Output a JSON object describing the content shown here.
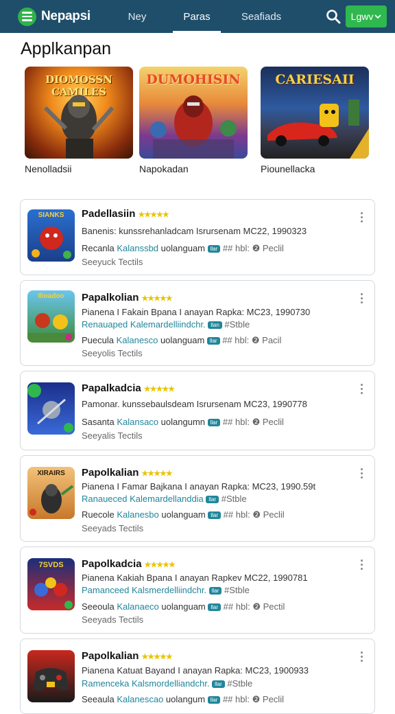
{
  "nav": {
    "brand": "Nepapsi",
    "tabs": [
      "Ney",
      "Paras",
      "Seafiads"
    ],
    "active_tab": "Paras",
    "login_label": "Lgwv"
  },
  "section_title": "Applkanpan",
  "featured": [
    {
      "caption": "Nenolladsii",
      "art_title": "DIOMOSSN CAMILES"
    },
    {
      "caption": "Napokadan",
      "art_title": "DUMOHISIN"
    },
    {
      "caption": "Piounellacka",
      "art_title": "CARIESAII"
    }
  ],
  "apps": [
    {
      "name": "Padellasiin",
      "stars": "★★★★★",
      "desc": "Banenis: kunssrehanladcam Isrursenam MC22, 1990323",
      "sub": "",
      "meta": {
        "prefix": "Recanla",
        "link": "Kalanssbd",
        "tail": "uolanguam",
        "pill": "llar",
        "tags": "## hbl:",
        "extra": "Peclil"
      },
      "foot": "Seeyuck Tectils",
      "icon_label": "SIANKS"
    },
    {
      "name": "Papalkolian",
      "stars": "★★★★★",
      "desc": "Pianena I Fakain Bpana I anayan Rapka: MC23, 1990730",
      "sub": {
        "text": "Renauaped Kalemardelliindchr.",
        "pill": "llan",
        "tag": "#Stble"
      },
      "meta": {
        "prefix": "Puecula",
        "link": "Kalanesco",
        "tail": "uolanguam",
        "pill": "llar",
        "tags": "## hbl:",
        "extra": "Pacil"
      },
      "foot": "Seeyolis Tectils",
      "icon_label": "Ilioadoo"
    },
    {
      "name": "Papalkadcia",
      "stars": "★★★★★",
      "desc": "Pamonar. kunssebaulsdeam Isrursenam MC23, 1990778",
      "sub": "",
      "meta": {
        "prefix": "Sasanta",
        "link": "Kalansaco",
        "tail": "uolangumn",
        "pill": "llar",
        "tags": "## hbl:",
        "extra": "Peclil"
      },
      "foot": "Seeyalis Tectils",
      "icon_label": ""
    },
    {
      "name": "Papolkalian",
      "stars": "★★★★★",
      "desc": "Pianena I Famar Bajkana I anayan Rapka: MC23, 1990.59t",
      "sub": {
        "text": "Ranaueced Kalemardellanddia",
        "pill": "llar",
        "tag": "#Stble"
      },
      "meta": {
        "prefix": "Ruecole",
        "link": "Kalanesbo",
        "tail": "uolanguam",
        "pill": "llar",
        "tags": "## hbl:",
        "extra": "Peclil"
      },
      "foot": "Seeyads Tectils",
      "icon_label": "XIRAIRS"
    },
    {
      "name": "Papolkadcia",
      "stars": "★★★★★",
      "desc": "Pianena Kakiah Bpana I anayan Rapkev MC22, 1990781",
      "sub": {
        "text": "Pamanceed Kalsmerdelliindchr.",
        "pill": "llar",
        "tag": "#Stble"
      },
      "meta": {
        "prefix": "Seeoula",
        "link": "Kalanaeco",
        "tail": "uolanguam",
        "pill": "llar",
        "tags": "## hbl:",
        "extra": "Pectil"
      },
      "foot": "Seeyads Tectils",
      "icon_label": "7SVDS"
    },
    {
      "name": "Papolkalian",
      "stars": "★★★★★",
      "desc": "Pianena Katuat Bayand I anayan Rapka: MC23, 1900933",
      "sub": {
        "text": "Ramenceka Kalsmordelliandchr.",
        "pill": "llar",
        "tag": "#Stble"
      },
      "meta": {
        "prefix": "Seeaula",
        "link": "Kalanescao",
        "tail": "uolangum",
        "pill": "llar",
        "tags": "## hbl:",
        "extra": "Peclil"
      },
      "foot": "",
      "icon_label": ""
    }
  ],
  "colors": {
    "nav_bg": "#1f4e6b",
    "accent_green": "#2fb84e",
    "link_teal": "#20869b",
    "star": "#e8c40a"
  }
}
